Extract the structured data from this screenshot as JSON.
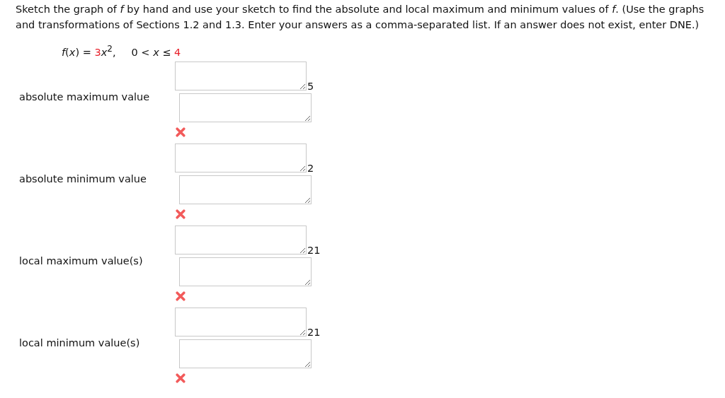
{
  "instructions": "Sketch the graph of *f* by hand and use your sketch to find the absolute and local maximum and minimum values of *f*. (Use the graphs and transformations of Sections 1.2 and 1.3. Enter your answers as a comma-separated list. If an answer does not exist, enter DNE.)",
  "formula": {
    "left": "*f*(*x*) = ",
    "coefficient": "3",
    "term": "*x*$^{2}$,",
    "domain": "0 < *x* ≤ ",
    "bound": "4"
  },
  "answers": [
    {
      "label": "absolute maximum value",
      "upper_value": "5",
      "correct": false
    },
    {
      "label": "absolute minimum value",
      "upper_value": "2",
      "correct": false
    },
    {
      "label": "local maximum value(s)",
      "upper_value": "21",
      "correct": false
    },
    {
      "label": "local minimum value(s)",
      "upper_value": "21",
      "correct": false
    }
  ]
}
